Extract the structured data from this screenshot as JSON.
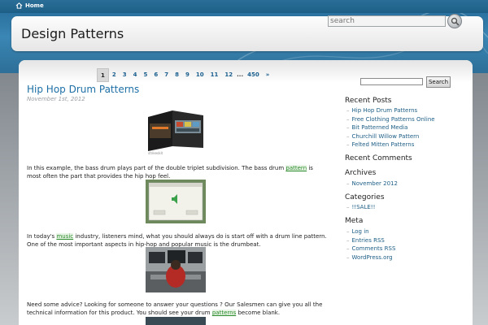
{
  "topbar": {
    "home_label": "Home"
  },
  "header": {
    "site_title": "Design Patterns",
    "search_placeholder": "search"
  },
  "pagination": {
    "current": "1",
    "pages": [
      "2",
      "3",
      "4",
      "5",
      "6",
      "7",
      "8",
      "9",
      "10",
      "11",
      "12"
    ],
    "ellipsis": "...",
    "last": "450",
    "next": "»"
  },
  "post": {
    "title": "Hip Hop Drum Patterns",
    "date": "November 1st, 2012",
    "para1_before": "In this example, the bass drum plays part of the double triplet subdivision. The bass drum ",
    "para1_link": "pattern",
    "para1_after": " is most often the part that provides the hip hop feel.",
    "para2_before": "In today's ",
    "para2_link": "music",
    "para2_after": " industry, listeners mind, what you should always do is start off with a drum line pattern. One of the most important aspects in hip-hop and popular music is the drumbeat.",
    "para3_before": "Need some advice? Looking for someone to answer your questions ? Our Salesmen can give you all the technical information for this product. You should see your drum ",
    "para3_link": "patterns",
    "para3_after": " become blank."
  },
  "sidebar": {
    "search_button": "Search",
    "recent_posts_title": "Recent Posts",
    "recent_posts": [
      "Hip Hop Drum Patterns",
      "Free Clothing Patterns Online",
      "Bit Patterned Media",
      "Churchill Willow Pattern",
      "Felted Mitten Patterns"
    ],
    "recent_comments_title": "Recent Comments",
    "archives_title": "Archives",
    "archives": [
      "November 2012"
    ],
    "categories_title": "Categories",
    "categories": [
      "!!SALE!!"
    ],
    "meta_title": "Meta",
    "meta": [
      "Log in",
      "Entries RSS",
      "Comments RSS",
      "WordPress.org"
    ]
  },
  "colors": {
    "accent": "#1d6fa6",
    "topbar": "#1d5e86",
    "link_highlight": "#2b8a2b"
  }
}
